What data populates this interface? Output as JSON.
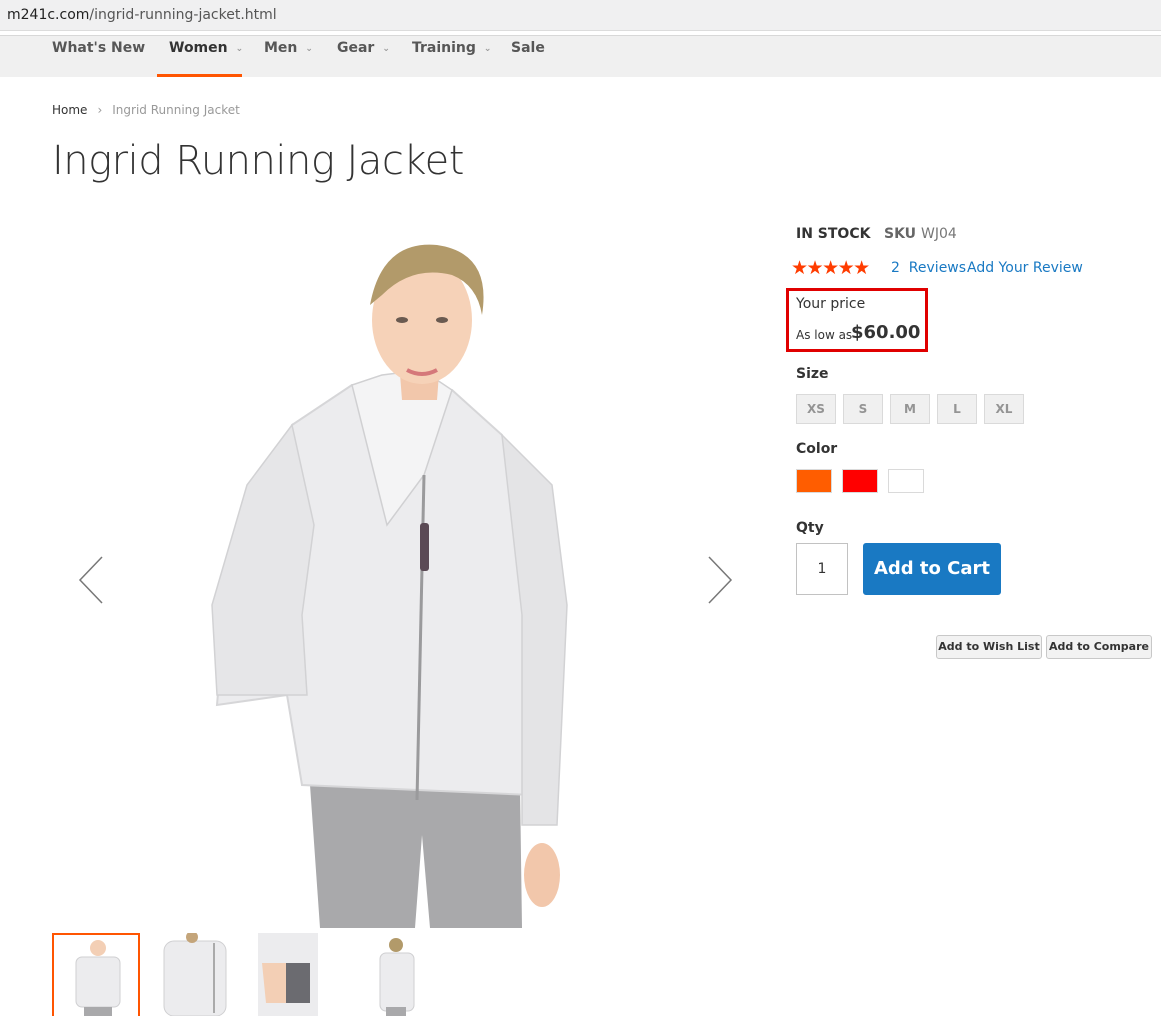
{
  "browser": {
    "url_host": "m241c.com",
    "url_path": "/ingrid-running-jacket.html"
  },
  "nav": {
    "items": [
      {
        "label": "What's New",
        "has_caret": false
      },
      {
        "label": "Women",
        "has_caret": true,
        "active": true
      },
      {
        "label": "Men",
        "has_caret": true
      },
      {
        "label": "Gear",
        "has_caret": true
      },
      {
        "label": "Training",
        "has_caret": true
      },
      {
        "label": "Sale",
        "has_caret": false
      }
    ],
    "caret_glyph": "⌄"
  },
  "breadcrumb": {
    "home": "Home",
    "separator": "›",
    "current": "Ingrid Running Jacket"
  },
  "product": {
    "title": "Ingrid Running Jacket",
    "stock": "IN STOCK",
    "sku_label": "SKU",
    "sku": "WJ04",
    "rating": {
      "stars_filled": 5,
      "stars_total": 5,
      "glyphs": "★★★★★"
    },
    "reviews_link": "2  Reviews",
    "add_review_link": "Add Your Review",
    "price": {
      "label": "Your price",
      "low_prefix": "As low as",
      "value": "$60.00"
    },
    "size": {
      "label": "Size",
      "options": [
        "XS",
        "S",
        "M",
        "L",
        "XL"
      ]
    },
    "color": {
      "label": "Color",
      "options": [
        {
          "name": "orange",
          "hex": "#ff5d00"
        },
        {
          "name": "red",
          "hex": "#ff0000"
        },
        {
          "name": "white",
          "hex": "#ffffff"
        }
      ]
    },
    "qty": {
      "label": "Qty",
      "value": "1"
    },
    "add_to_cart": "Add to Cart",
    "wishlist": "Add to Wish List",
    "compare": "Add to Compare"
  },
  "gallery": {
    "thumbnail_count": 4,
    "active_thumbnail": 1
  },
  "colors": {
    "accent": "#ff5501",
    "link": "#1979c3",
    "highlight": "#e00000",
    "star": "#ff3c00"
  }
}
